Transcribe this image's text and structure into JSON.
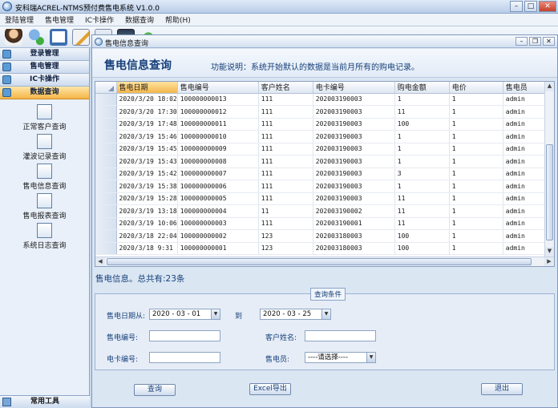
{
  "window": {
    "title": "安科瑞ACREL-NTMS预付费售电系统 V1.0.0"
  },
  "menu": [
    "登陆管理",
    "售电管理",
    "IC卡操作",
    "数据查询",
    "帮助(H)"
  ],
  "sidebar": {
    "sections": [
      "登录管理",
      "售电管理",
      "IC卡操作",
      "数据查询"
    ],
    "active_section": "数据查询",
    "items": [
      "正常客户查询",
      "灌波记录查询",
      "售电信息查询",
      "售电报表查询",
      "系统日志查询"
    ],
    "bottom": "常用工具"
  },
  "child": {
    "title": "售电信息查询",
    "heading": "售电信息查询",
    "description": "功能说明：系统开始默认的数据是当前月所有的购电记录。"
  },
  "table": {
    "columns": [
      "售电日期",
      "售电编号",
      "客户姓名",
      "电卡编号",
      "购电金额",
      "电价",
      "售电员"
    ],
    "rows": [
      [
        "2020/3/20 18:02",
        "100000000013",
        "111",
        "202003190003",
        "1",
        "1",
        "admin"
      ],
      [
        "2020/3/20 17:30",
        "100000000012",
        "111",
        "202003190003",
        "11",
        "1",
        "admin"
      ],
      [
        "2020/3/19 17:48",
        "100000000011",
        "111",
        "202003190003",
        "100",
        "1",
        "admin"
      ],
      [
        "2020/3/19 15:46",
        "100000000010",
        "111",
        "202003190003",
        "1",
        "1",
        "admin"
      ],
      [
        "2020/3/19 15:45",
        "100000000009",
        "111",
        "202003190003",
        "1",
        "1",
        "admin"
      ],
      [
        "2020/3/19 15:43",
        "100000000008",
        "111",
        "202003190003",
        "1",
        "1",
        "admin"
      ],
      [
        "2020/3/19 15:42",
        "100000000007",
        "111",
        "202003190003",
        "3",
        "1",
        "admin"
      ],
      [
        "2020/3/19 15:38",
        "100000000006",
        "111",
        "202003190003",
        "1",
        "1",
        "admin"
      ],
      [
        "2020/3/19 15:28",
        "100000000005",
        "111",
        "202003190003",
        "11",
        "1",
        "admin"
      ],
      [
        "2020/3/19 13:18",
        "100000000004",
        "11",
        "202003190002",
        "11",
        "1",
        "admin"
      ],
      [
        "2020/3/19 10:06",
        "100000000003",
        "111",
        "202003190001",
        "11",
        "1",
        "admin"
      ],
      [
        "2020/3/18 22:04",
        "100000000002",
        "123",
        "202003180003",
        "100",
        "1",
        "admin"
      ],
      [
        "2020/3/18 9:31",
        "100000000001",
        "123",
        "202003180003",
        "100",
        "1",
        "admin"
      ]
    ]
  },
  "summary": "售电信息。总共有:23条",
  "query": {
    "legend": "查询条件",
    "date_from_label": "售电日期从:",
    "date_from": "2020 - 03 - 01",
    "to_label": "到",
    "date_to": "2020 - 03 - 25",
    "sale_no_label": "售电编号:",
    "customer_label": "客户姓名:",
    "card_no_label": "电卡编号:",
    "seller_label": "售电员:",
    "seller_value": "----请选择----"
  },
  "buttons": {
    "search": "查询",
    "export": "Excel导出",
    "exit": "退出"
  }
}
